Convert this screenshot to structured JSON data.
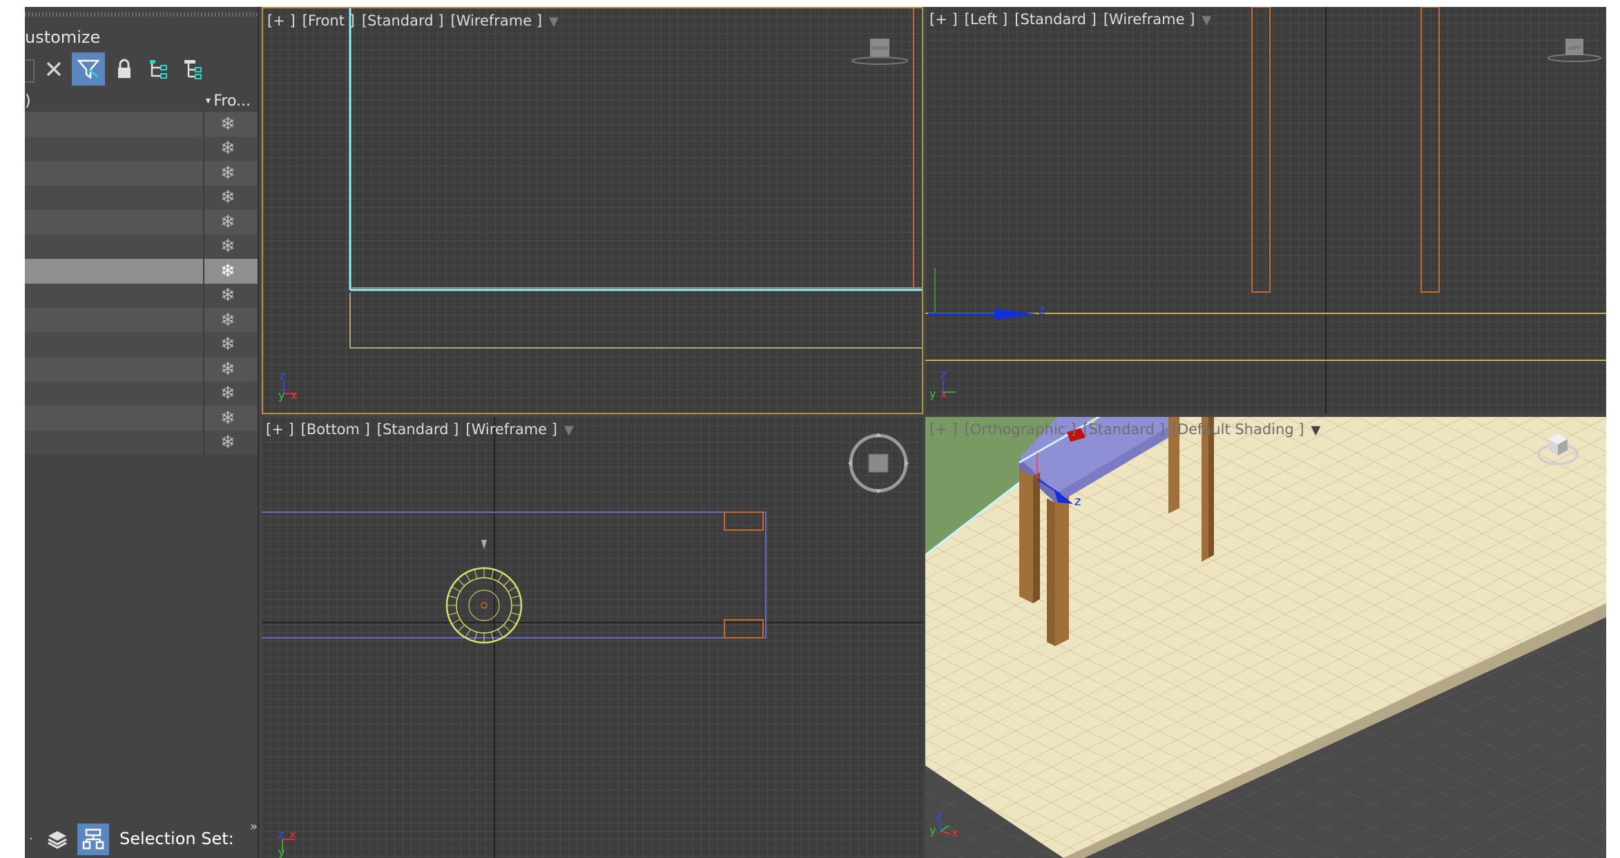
{
  "panel": {
    "menu_label": "ustomize",
    "column_id_fragment": ")",
    "column_freeze": "Fro...",
    "rows": [
      {
        "freeze": "❄"
      },
      {
        "freeze": "❄"
      },
      {
        "freeze": "❄"
      },
      {
        "freeze": "❄"
      },
      {
        "freeze": "❄"
      },
      {
        "freeze": "❄"
      },
      {
        "freeze": "❄"
      },
      {
        "freeze": "❄"
      },
      {
        "freeze": "❄"
      },
      {
        "freeze": "❄"
      },
      {
        "freeze": "❄"
      },
      {
        "freeze": "❄"
      },
      {
        "freeze": "❄"
      },
      {
        "freeze": "❄"
      }
    ],
    "selected_row": 6,
    "toolbar_icons": [
      "close-icon",
      "filter-icon",
      "lock-icon",
      "hierarchy-icon",
      "hierarchy-alt-icon"
    ],
    "bottom": {
      "dots": "·",
      "selection_set_label": "Selection Set:",
      "chevron": "»"
    }
  },
  "viewports": {
    "front": {
      "plus": "[+ ]",
      "view": "[Front ]",
      "mode": "[Standard ]",
      "shading": "[Wireframe ]",
      "viewcube": "FRONT",
      "axes": {
        "up": "z",
        "right": "x",
        "origin": "y"
      }
    },
    "left": {
      "plus": "[+ ]",
      "view": "[Left ]",
      "mode": "[Standard ]",
      "shading": "[Wireframe ]",
      "viewcube": "LEFT",
      "axes": {
        "up": "z",
        "right": "y",
        "origin": "x"
      },
      "gizmo_axis": "z"
    },
    "bottom": {
      "plus": "[+ ]",
      "view": "[Bottom ]",
      "mode": "[Standard ]",
      "shading": "[Wireframe ]",
      "axes": {
        "up": "z",
        "right": "x",
        "origin": "y"
      }
    },
    "persp": {
      "plus": "[+ ]",
      "view": "[Orthographic ]",
      "mode": "[Standard ]",
      "shading": "[Default Shading ]",
      "axes": {
        "up": "z",
        "right": "x",
        "origin": "y"
      },
      "gizmo_axis": "z",
      "gizmo_x": "X"
    }
  },
  "colors": {
    "selection_accent": "#5b87c0",
    "active_viewport_border": "#b8923a",
    "floor": "#efe4c0",
    "table_top": "#8f8fd6",
    "table_legs": "#a0703a",
    "wall": "#7a9a63"
  }
}
